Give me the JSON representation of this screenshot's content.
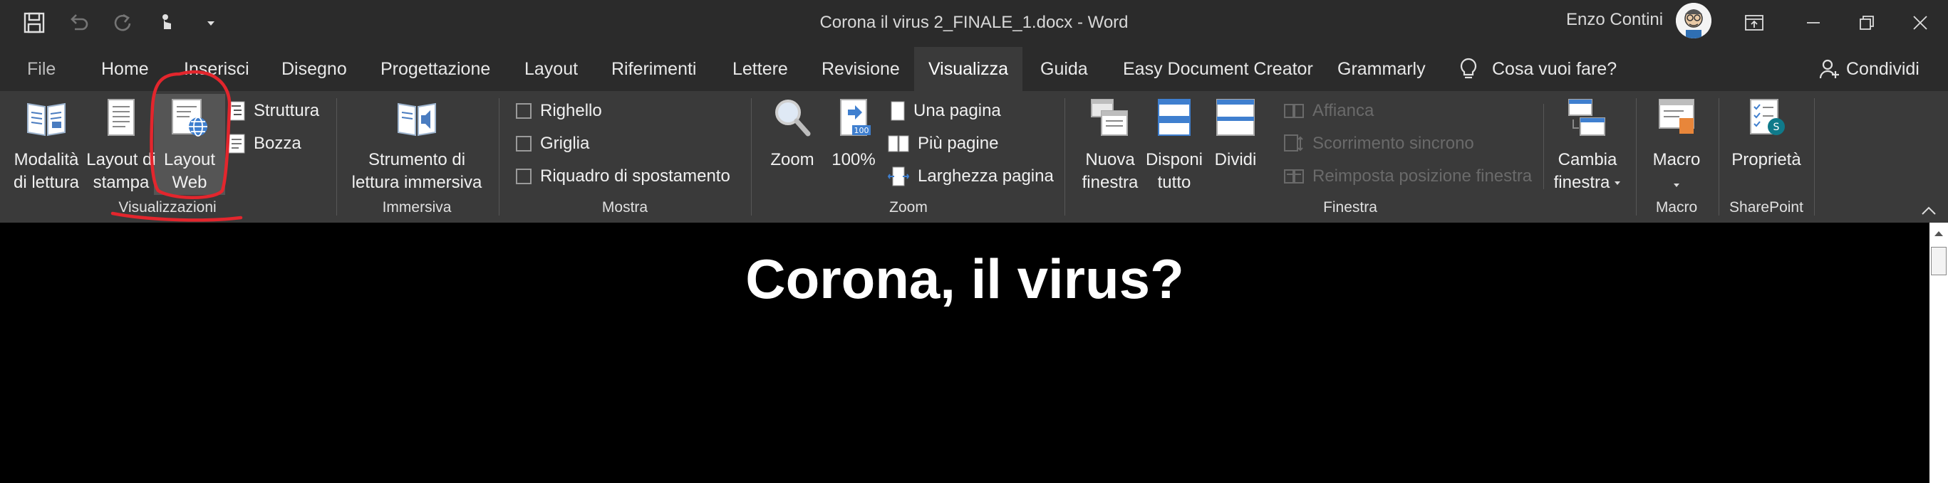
{
  "title_bar": {
    "document_title": "Corona il virus 2_FINALE_1.docx  -  Word",
    "user_name": "Enzo Contini",
    "qat_icons": [
      "save-icon",
      "undo-icon",
      "redo-icon",
      "touch-mode-icon",
      "customize-qat-icon"
    ],
    "window_icons": [
      "ribbon-display-options-icon",
      "minimize-icon",
      "restore-icon",
      "close-icon"
    ]
  },
  "tabs": [
    {
      "label": "File"
    },
    {
      "label": "Home"
    },
    {
      "label": "Inserisci"
    },
    {
      "label": "Disegno"
    },
    {
      "label": "Progettazione"
    },
    {
      "label": "Layout"
    },
    {
      "label": "Riferimenti"
    },
    {
      "label": "Lettere"
    },
    {
      "label": "Revisione"
    },
    {
      "label": "Visualizza"
    },
    {
      "label": "Guida"
    },
    {
      "label": "Easy Document Creator"
    },
    {
      "label": "Grammarly"
    }
  ],
  "active_tab": "Visualizza",
  "tell_me": "Cosa vuoi fare?",
  "share": "Condividi",
  "ribbon": {
    "visualizzazioni": {
      "label": "Visualizzazioni",
      "reading_mode": [
        "Modalità",
        "di lettura"
      ],
      "print_layout": [
        "Layout di",
        "stampa"
      ],
      "web_layout": [
        "Layout",
        "Web"
      ],
      "outline": "Struttura",
      "draft": "Bozza"
    },
    "immersiva": {
      "label": "Immersiva",
      "immersive_reader": [
        "Strumento di",
        "lettura immersiva"
      ]
    },
    "mostra": {
      "label": "Mostra",
      "ruler": "Righello",
      "gridlines": "Griglia",
      "navigation_pane": "Riquadro di spostamento"
    },
    "zoom": {
      "label": "Zoom",
      "zoom": "Zoom",
      "hundred": "100%",
      "one_page": "Una pagina",
      "multiple_pages": "Più pagine",
      "page_width": "Larghezza pagina"
    },
    "finestra": {
      "label": "Finestra",
      "new_window": [
        "Nuova",
        "finestra"
      ],
      "arrange_all": [
        "Disponi",
        "tutto"
      ],
      "split": "Dividi",
      "side_by_side": "Affianca",
      "sync_scroll": "Scorrimento sincrono",
      "reset_position": "Reimposta posizione finestra",
      "switch_windows": [
        "Cambia",
        "finestra"
      ]
    },
    "macro": {
      "label": "Macro",
      "macros": "Macro"
    },
    "sharepoint": {
      "label": "SharePoint",
      "properties": "Proprietà"
    }
  },
  "document": {
    "heading": "Corona, il virus?"
  },
  "colors": {
    "titlebar_bg": "#2b2b2b",
    "ribbon_bg": "#3a3a3a",
    "annotation_red": "#e3262d"
  }
}
